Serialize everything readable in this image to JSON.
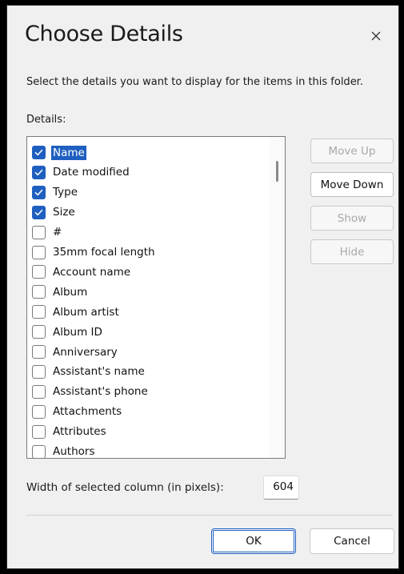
{
  "dialog": {
    "title": "Choose Details",
    "description": "Select the details you want to display for the items in this folder.",
    "details_label": "Details:"
  },
  "list": {
    "items": [
      {
        "label": "Name",
        "checked": true,
        "selected": true
      },
      {
        "label": "Date modified",
        "checked": true,
        "selected": false
      },
      {
        "label": "Type",
        "checked": true,
        "selected": false
      },
      {
        "label": "Size",
        "checked": true,
        "selected": false
      },
      {
        "label": "#",
        "checked": false,
        "selected": false
      },
      {
        "label": "35mm focal length",
        "checked": false,
        "selected": false
      },
      {
        "label": "Account name",
        "checked": false,
        "selected": false
      },
      {
        "label": "Album",
        "checked": false,
        "selected": false
      },
      {
        "label": "Album artist",
        "checked": false,
        "selected": false
      },
      {
        "label": "Album ID",
        "checked": false,
        "selected": false
      },
      {
        "label": "Anniversary",
        "checked": false,
        "selected": false
      },
      {
        "label": "Assistant's name",
        "checked": false,
        "selected": false
      },
      {
        "label": "Assistant's phone",
        "checked": false,
        "selected": false
      },
      {
        "label": "Attachments",
        "checked": false,
        "selected": false
      },
      {
        "label": "Attributes",
        "checked": false,
        "selected": false
      },
      {
        "label": "Authors",
        "checked": false,
        "selected": false
      }
    ]
  },
  "buttons": {
    "move_up": "Move Up",
    "move_down": "Move Down",
    "show": "Show",
    "hide": "Hide",
    "ok": "OK",
    "cancel": "Cancel"
  },
  "width": {
    "label": "Width of selected column (in pixels):",
    "value": "604"
  },
  "colors": {
    "accent": "#1f5fbf",
    "background": "#f0f0f0"
  }
}
